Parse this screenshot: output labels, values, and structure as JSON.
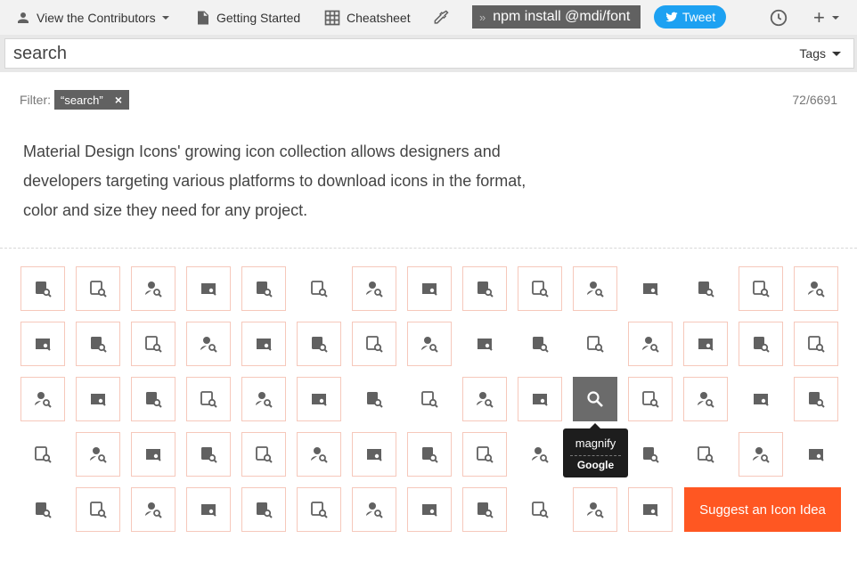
{
  "nav": {
    "contributors_label": "View the Contributors",
    "getting_started_label": "Getting Started",
    "cheatsheet_label": "Cheatsheet",
    "npm_command": "npm install @mdi/font",
    "npm_chevron": "»",
    "tweet_label": "Tweet",
    "add_label": "+"
  },
  "search": {
    "value": "search",
    "tags_label": "Tags"
  },
  "filter": {
    "label": "Filter:",
    "chip_text": "“search”",
    "chip_close": "×",
    "count": "72/6691"
  },
  "description": {
    "line1": "Material Design Icons' growing icon collection allows designers and",
    "line2": "developers targeting various platforms to download icons in the format,",
    "line3": "color and size they need for any project."
  },
  "icons": [
    {
      "name": "account-search-icon",
      "bordered": true
    },
    {
      "name": "account-search-outline-icon",
      "bordered": true
    },
    {
      "name": "airplane-search-icon",
      "bordered": true
    },
    {
      "name": "archive-search-icon",
      "bordered": true
    },
    {
      "name": "archive-search-outline-icon",
      "bordered": true
    },
    {
      "name": "bluetooth-audio-icon",
      "bordered": false
    },
    {
      "name": "book-search-icon",
      "bordered": true
    },
    {
      "name": "book-search-outline-icon",
      "bordered": true
    },
    {
      "name": "briefcase-search-icon",
      "bordered": true
    },
    {
      "name": "briefcase-search-outline-icon",
      "bordered": true
    },
    {
      "name": "calendar-search-icon",
      "bordered": true
    },
    {
      "name": "card-search-icon",
      "bordered": false
    },
    {
      "name": "card-search-outline-icon",
      "bordered": false
    },
    {
      "name": "clipboard-search-icon",
      "bordered": true
    },
    {
      "name": "clipboard-search-outline-icon",
      "bordered": true
    },
    {
      "name": "clipboard-text-search-icon",
      "bordered": true
    },
    {
      "name": "clipboard-text-search-outline-icon",
      "bordered": true
    },
    {
      "name": "cloud-search-icon",
      "bordered": true
    },
    {
      "name": "cloud-search-outline-icon",
      "bordered": true
    },
    {
      "name": "comment-search-icon",
      "bordered": true
    },
    {
      "name": "comment-search-outline-icon",
      "bordered": true
    },
    {
      "name": "credit-card-search-icon",
      "bordered": true
    },
    {
      "name": "credit-card-search-outline-icon",
      "bordered": true
    },
    {
      "name": "crosshairs-icon",
      "bordered": false
    },
    {
      "name": "database-search-icon",
      "bordered": false
    },
    {
      "name": "database-search-outline-icon",
      "bordered": false
    },
    {
      "name": "email-search-icon",
      "bordered": true
    },
    {
      "name": "email-search-outline-icon",
      "bordered": true
    },
    {
      "name": "file-document-search-icon",
      "bordered": true
    },
    {
      "name": "file-document-search-outline-icon",
      "bordered": true
    },
    {
      "name": "file-search-icon",
      "bordered": true
    },
    {
      "name": "file-search-outline-icon",
      "bordered": true
    },
    {
      "name": "folder-search-icon",
      "bordered": true
    },
    {
      "name": "folder-search-outline-icon",
      "bordered": true
    },
    {
      "name": "home-search-icon",
      "bordered": true
    },
    {
      "name": "home-search-outline-icon",
      "bordered": true
    },
    {
      "name": "image-search-icon",
      "bordered": false
    },
    {
      "name": "image-search-outline-icon",
      "bordered": false
    },
    {
      "name": "layers-search-icon",
      "bordered": true
    },
    {
      "name": "layers-search-outline-icon",
      "bordered": true
    },
    {
      "name": "magnify-icon",
      "bordered": false,
      "selected": true
    },
    {
      "name": "magnify-scan-icon",
      "bordered": true
    },
    {
      "name": "magnify-minus-icon",
      "bordered": true
    },
    {
      "name": "magnify-minus-outline-icon",
      "bordered": false
    },
    {
      "name": "magnify-plus-icon",
      "bordered": true
    },
    {
      "name": "magnify-plus-outline-icon",
      "bordered": false
    },
    {
      "name": "map-search-icon",
      "bordered": true
    },
    {
      "name": "map-search-outline-icon",
      "bordered": true
    },
    {
      "name": "movie-search-icon",
      "bordered": true
    },
    {
      "name": "movie-search-outline-icon",
      "bordered": true
    },
    {
      "name": "note-search-icon",
      "bordered": true
    },
    {
      "name": "file-find-icon",
      "bordered": true
    },
    {
      "name": "file-find-outline-icon",
      "bordered": true
    },
    {
      "name": "printer-search-icon",
      "bordered": true
    },
    {
      "name": "search-web-icon",
      "bordered": false
    },
    {
      "name": "selection-search-icon",
      "bordered": false
    },
    {
      "name": "select-search-icon",
      "bordered": false
    },
    {
      "name": "shield-search-icon",
      "bordered": false
    },
    {
      "name": "shopping-search-icon",
      "bordered": true
    },
    {
      "name": "steering-icon",
      "bordered": false
    },
    {
      "name": "steering-off-icon",
      "bordered": false
    },
    {
      "name": "store-search-icon",
      "bordered": true
    },
    {
      "name": "text-box-search-icon",
      "bordered": true
    },
    {
      "name": "television-search-icon",
      "bordered": true
    },
    {
      "name": "tab-search-icon",
      "bordered": true
    },
    {
      "name": "tag-search-icon",
      "bordered": true
    },
    {
      "name": "tag-search-outline-icon",
      "bordered": true
    },
    {
      "name": "text-search-icon",
      "bordered": true
    },
    {
      "name": "text-box-search-outline-icon",
      "bordered": true
    },
    {
      "name": "text-search-variant-icon",
      "bordered": false
    },
    {
      "name": "toolbox-search-icon",
      "bordered": true
    },
    {
      "name": "toolbox-search-outline-icon",
      "bordered": true
    }
  ],
  "tooltip": {
    "name": "magnify",
    "author": "Google"
  },
  "suggest_label": "Suggest an Icon Idea",
  "colors": {
    "accent": "#ff5722",
    "tweet": "#1da1f2",
    "icon": "#616161",
    "tile_border": "#f6c8bb"
  }
}
